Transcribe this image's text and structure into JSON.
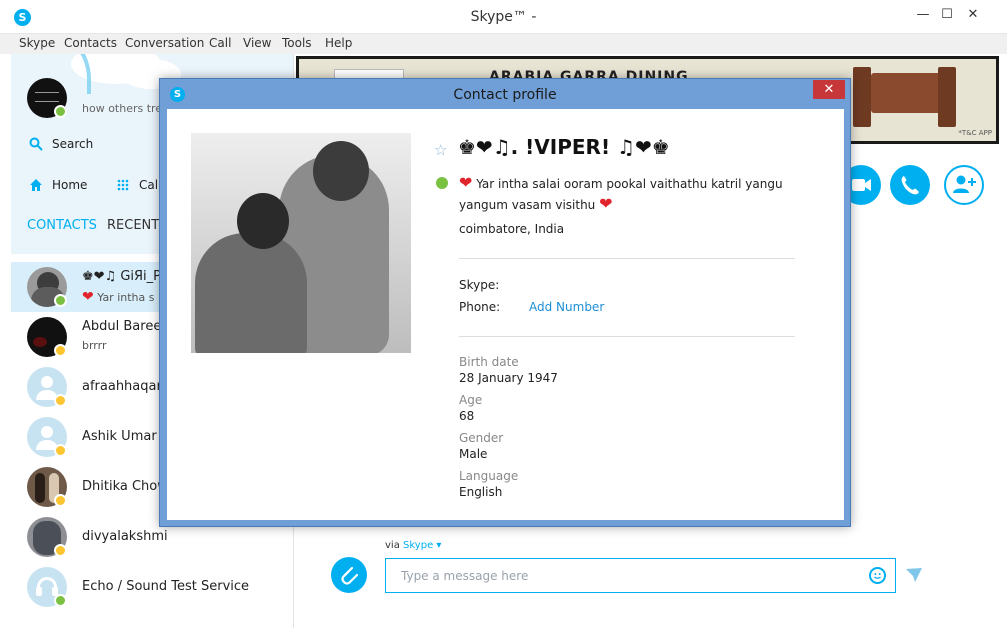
{
  "window": {
    "title": "Skype™ -",
    "app_icon": "S",
    "minimize": "—",
    "maximize": "☐",
    "close": "✕"
  },
  "menu": [
    "Skype",
    "Contacts",
    "Conversation",
    "Call",
    "View",
    "Tools",
    "Help"
  ],
  "sidebar": {
    "mood_message": "how others tre",
    "search_label": "Search",
    "home_label": "Home",
    "call_label": "Call",
    "tabs": {
      "contacts": "CONTACTS",
      "recent": "RECENT"
    },
    "contacts": [
      {
        "name": "♚❤♫ GiЯi_P",
        "mood": "Yar intha s",
        "status": "online"
      },
      {
        "name": "Abdul Baree",
        "mood": "brrrr",
        "status": "away"
      },
      {
        "name": "afraahhaqani",
        "mood": "",
        "status": "away"
      },
      {
        "name": "Ashik Umar",
        "mood": "",
        "status": "away"
      },
      {
        "name": "Dhitika  Chow",
        "mood": "",
        "status": "away"
      },
      {
        "name": "divyalakshmi",
        "mood": "",
        "status": "away"
      },
      {
        "name": "Echo / Sound Test Service",
        "mood": "",
        "status": "online"
      }
    ]
  },
  "banner": {
    "text": "ARABIA GARRA DINING",
    "note": "*T&C APP"
  },
  "compose": {
    "via_label": "via",
    "via_link": "Skype",
    "placeholder": "Type a message here"
  },
  "dialog": {
    "title": "Contact profile",
    "close": "✕",
    "profile": {
      "display_name": "♚❤♫.   !VIPER!   ♫❤♚",
      "mood": "Yar intha salai ooram pookal vaithathu katril yangu yangum vasam visithu",
      "location": "coimbatore, India",
      "skype_label": "Skype:",
      "phone_label": "Phone:",
      "add_number": "Add Number",
      "fields": [
        {
          "label": "Birth date",
          "value": "28 January 1947"
        },
        {
          "label": "Age",
          "value": "68"
        },
        {
          "label": "Gender",
          "value": "Male"
        },
        {
          "label": "Language",
          "value": "English"
        }
      ]
    }
  },
  "colors": {
    "accent": "#00aff0",
    "online": "#7ac142",
    "away": "#fdc531",
    "dialog_frame": "#6f9fd6",
    "close_red": "#c7373a"
  }
}
